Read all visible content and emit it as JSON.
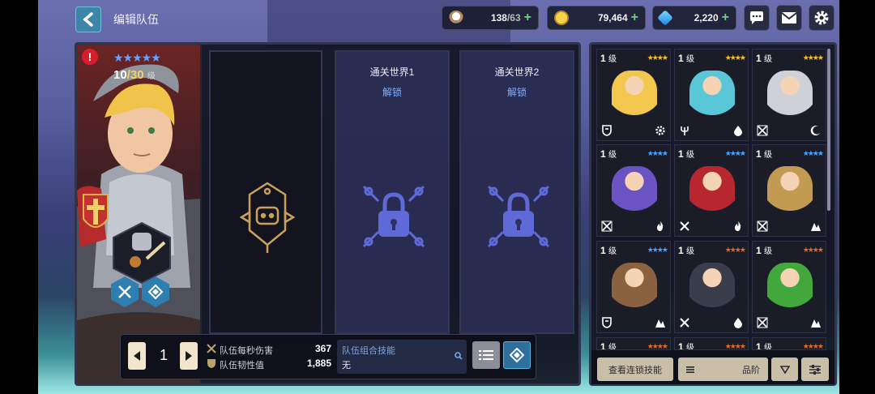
{
  "header": {
    "title": "编辑队伍"
  },
  "resources": {
    "stamina": {
      "current": "138",
      "max": "/63"
    },
    "gold": {
      "value": "79,464"
    },
    "gems": {
      "value": "2,220"
    }
  },
  "hero": {
    "level": "10",
    "level_max": "/30",
    "level_unit": "级",
    "stars": "★★★★★",
    "warning": "!"
  },
  "slots": [
    {
      "title": "",
      "sub": ""
    },
    {
      "title": "通关世界1",
      "sub": "解锁"
    },
    {
      "title": "通关世界2",
      "sub": "解锁"
    }
  ],
  "team": {
    "count": "1",
    "dps_label": "队伍每秒伤害",
    "dps_value": "367",
    "toughness_label": "队伍韧性值",
    "toughness_value": "1,885",
    "combo_title": "队伍组合技能",
    "combo_value": "无"
  },
  "roster": {
    "cells": [
      {
        "level": "1",
        "unit": "级",
        "stars": "★★★★",
        "star_color": "#f2c230",
        "sprite": "#f3c74d",
        "left": "shield",
        "right": "gear"
      },
      {
        "level": "1",
        "unit": "级",
        "stars": "★★★★",
        "star_color": "#f2c230",
        "sprite": "#5ac7d8",
        "left": "trident",
        "right": "drop"
      },
      {
        "level": "1",
        "unit": "级",
        "stars": "★★★★",
        "star_color": "#f2c230",
        "sprite": "#cfd0d8",
        "left": "cross",
        "right": "moon"
      },
      {
        "level": "1",
        "unit": "级",
        "stars": "★★★★",
        "star_color": "#4aa2ff",
        "sprite": "#6b53c4",
        "left": "cross",
        "right": "fire"
      },
      {
        "level": "1",
        "unit": "级",
        "stars": "★★★★",
        "star_color": "#4aa2ff",
        "sprite": "#b8262f",
        "left": "sword",
        "right": "fire"
      },
      {
        "level": "1",
        "unit": "级",
        "stars": "★★★★",
        "star_color": "#4aa2ff",
        "sprite": "#c29a52",
        "left": "cross",
        "right": "peak"
      },
      {
        "level": "1",
        "unit": "级",
        "stars": "★★★★",
        "star_color": "#4aa2ff",
        "sprite": "#8a6240",
        "left": "shield",
        "right": "peak"
      },
      {
        "level": "1",
        "unit": "级",
        "stars": "★★★★",
        "star_color": "#e06a2a",
        "sprite": "#3a3d4c",
        "left": "sword",
        "right": "drop"
      },
      {
        "level": "1",
        "unit": "级",
        "stars": "★★★★",
        "star_color": "#e06a2a",
        "sprite": "#43a83b",
        "left": "cross",
        "right": "peak"
      },
      {
        "level": "1",
        "unit": "级",
        "stars": "★★★★",
        "star_color": "#e06a2a",
        "sprite": "#444",
        "left": "",
        "right": ""
      },
      {
        "level": "1",
        "unit": "级",
        "stars": "★★★★",
        "star_color": "#e06a2a",
        "sprite": "#444",
        "left": "",
        "right": ""
      },
      {
        "level": "1",
        "unit": "级",
        "stars": "★★★★",
        "star_color": "#e06a2a",
        "sprite": "#444",
        "left": "",
        "right": ""
      }
    ],
    "chain_skill_label": "查看连锁技能",
    "sort_label": "品阶"
  },
  "colors": {
    "accent": "#3e86a8",
    "panel": "#12141f",
    "slot_locked": "#30345f"
  }
}
